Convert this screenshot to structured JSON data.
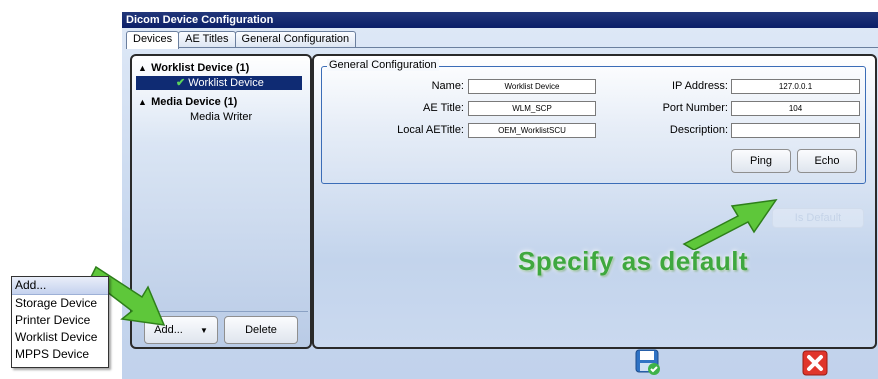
{
  "window": {
    "title": "Dicom Device Configuration"
  },
  "tabs": [
    {
      "label": "Devices",
      "active": true
    },
    {
      "label": "AE Titles",
      "active": false
    },
    {
      "label": "General Configuration",
      "active": false
    }
  ],
  "tree": {
    "groups": [
      {
        "label": "Worklist Device (1)",
        "children": [
          {
            "label": "Worklist Device",
            "selected": true,
            "checked": true
          }
        ]
      },
      {
        "label": "Media Device (1)",
        "children": [
          {
            "label": "Media Writer",
            "selected": false,
            "checked": false
          }
        ]
      }
    ]
  },
  "left_buttons": {
    "add": "Add...",
    "delete": "Delete"
  },
  "general": {
    "legend": "General Configuration",
    "name_label": "Name:",
    "name_value": "Worklist Device",
    "ae_title_label": "AE Title:",
    "ae_title_value": "WLM_SCP",
    "local_ae_label": "Local AETitle:",
    "local_ae_value": "OEM_WorklistSCU",
    "ip_label": "IP Address:",
    "ip_value": "127.0.0.1",
    "port_label": "Port Number:",
    "port_value": "104",
    "desc_label": "Description:",
    "desc_value": "",
    "ping_label": "Ping",
    "echo_label": "Echo"
  },
  "is_default_label": "Is Default",
  "annotation": {
    "text": "Specify as default"
  },
  "dropdown": {
    "items": [
      "Add...",
      "Storage Device",
      "Printer Device",
      "Worklist Device",
      "MPPS Device"
    ]
  },
  "footer": {
    "save_icon": "save-icon",
    "close_icon": "close-icon"
  },
  "colors": {
    "titlebar": "#0b1f68",
    "selection": "#0f2b73",
    "annotation": "#3fa83f",
    "close": "#e0352b"
  }
}
